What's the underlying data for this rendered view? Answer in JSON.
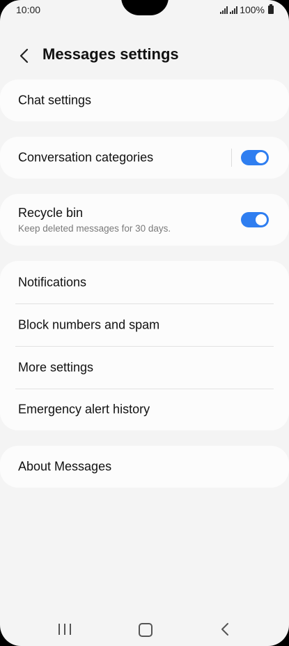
{
  "status_bar": {
    "time": "10:00",
    "battery_text": "100%",
    "icons": [
      "signal-icon",
      "signal-icon",
      "battery-icon"
    ]
  },
  "header": {
    "title": "Messages settings",
    "back_icon": "back-arrow-icon"
  },
  "settings": {
    "chat_settings": {
      "label": "Chat settings"
    },
    "conversation_categories": {
      "label": "Conversation categories",
      "toggle_on": true
    },
    "recycle_bin": {
      "label": "Recycle bin",
      "subtitle": "Keep deleted messages for 30 days.",
      "toggle_on": true
    },
    "group": {
      "items": [
        {
          "label": "Notifications"
        },
        {
          "label": "Block numbers and spam"
        },
        {
          "label": "More settings"
        },
        {
          "label": "Emergency alert history"
        }
      ]
    },
    "about": {
      "label": "About Messages"
    }
  },
  "nav_bar": {
    "icons": [
      "recent-apps-icon",
      "home-icon",
      "back-icon"
    ]
  },
  "colors": {
    "background": "#f4f4f4",
    "card": "#fcfcfc",
    "accent": "#2f7ef0",
    "subtitle": "#7a7a7a"
  }
}
